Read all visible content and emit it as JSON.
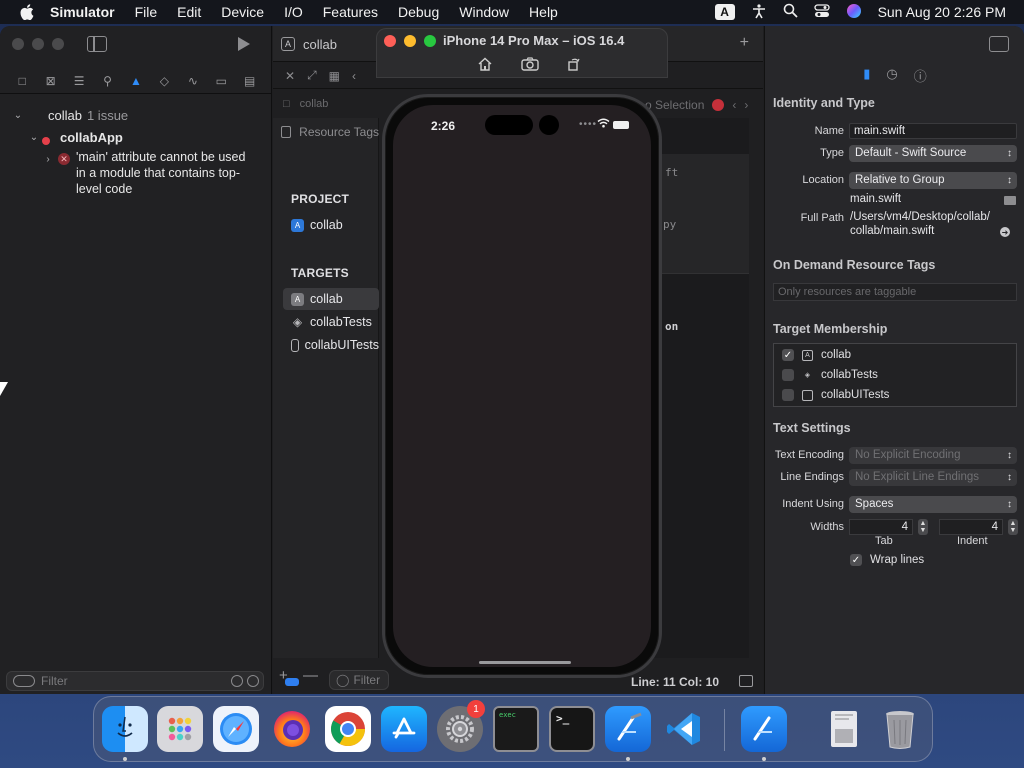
{
  "menubar": {
    "app": "Simulator",
    "items": [
      "File",
      "Edit",
      "Device",
      "I/O",
      "Features",
      "Debug",
      "Window",
      "Help"
    ],
    "input_source": "A",
    "clock": "Sun Aug 20  2:26 PM"
  },
  "navigator": {
    "project_name": "collab",
    "issue_count": "1 issue",
    "group_name": "collabApp",
    "issue_message": "'main' attribute cannot be used in a module that contains top-level code",
    "filter_placeholder": "Filter"
  },
  "editor": {
    "tab_title": "collab",
    "path_item": "collab",
    "no_selection": "o Selection",
    "resource_tags": "Resource Tags",
    "project_header": "PROJECT",
    "project_item": "collab",
    "targets_header": "TARGETS",
    "targets": [
      "collab",
      "collabTests",
      "collabUITests"
    ],
    "filter_placeholder": "Filter",
    "code_fragments": [
      "ft",
      "py",
      "on"
    ],
    "status_position": "Line: 11  Col: 10"
  },
  "inspector": {
    "identity_title": "Identity and Type",
    "name_label": "Name",
    "name_value": "main.swift",
    "type_label": "Type",
    "type_value": "Default - Swift Source",
    "location_label": "Location",
    "location_value": "Relative to Group",
    "location_file": "main.swift",
    "fullpath_label": "Full Path",
    "fullpath_line1": "/Users/vm4/Desktop/collab/",
    "fullpath_line2": "collab/main.swift",
    "ondemand_title": "On Demand Resource Tags",
    "ondemand_placeholder": "Only resources are taggable",
    "membership_title": "Target Membership",
    "membership": [
      {
        "name": "collab",
        "checked": true
      },
      {
        "name": "collabTests",
        "checked": false
      },
      {
        "name": "collabUITests",
        "checked": false
      }
    ],
    "text_settings_title": "Text Settings",
    "encoding_label": "Text Encoding",
    "encoding_value": "No Explicit Encoding",
    "line_endings_label": "Line Endings",
    "line_endings_value": "No Explicit Line Endings",
    "indent_using_label": "Indent Using",
    "indent_using_value": "Spaces",
    "widths_label": "Widths",
    "tab_width": "4",
    "indent_width": "4",
    "tab_caption": "Tab",
    "indent_caption": "Indent",
    "wrap_lines_label": "Wrap lines",
    "wrap_lines_checked": true
  },
  "simulator": {
    "title": "iPhone 14 Pro Max – iOS 16.4",
    "status_time": "2:26"
  },
  "dock": {
    "apps": [
      "finder",
      "launchpad",
      "safari",
      "firefox",
      "chrome",
      "app-store",
      "system-settings",
      "console",
      "terminal",
      "xcode",
      "vscode",
      "simulator",
      "preview",
      "trash"
    ],
    "settings_badge": "1",
    "console_label": "exec",
    "terminal_label": ">_"
  },
  "colors": {
    "accent": "#2f8cf8",
    "error": "#e5404a",
    "close": "#fe5f57",
    "minimize": "#febc2e",
    "zoom": "#28c840"
  }
}
